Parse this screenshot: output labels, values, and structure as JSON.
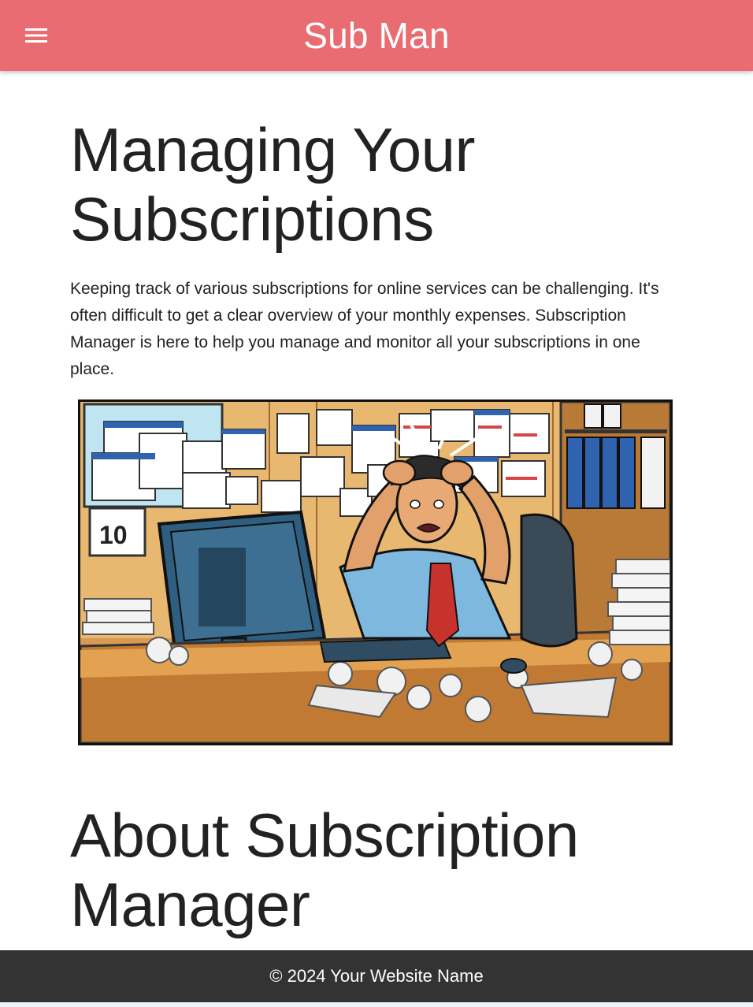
{
  "header": {
    "title": "Sub Man",
    "menu_icon": "hamburger-menu-icon",
    "background": "#ea6c73"
  },
  "main": {
    "heading": "Managing Your Subscriptions",
    "intro": "Keeping track of various subscriptions for online services can be challenging. It's often difficult to get a clear overview of your monthly expenses. Subscription Manager is here to help you manage and monitor all your subscriptions in one place.",
    "illustration": {
      "description_icon": "stressed-office-worker-illustration",
      "calendar_number": "10"
    },
    "about_heading": "About Subscription Manager"
  },
  "footer": {
    "text": "© 2024 Your Website Name",
    "background": "#333333"
  }
}
